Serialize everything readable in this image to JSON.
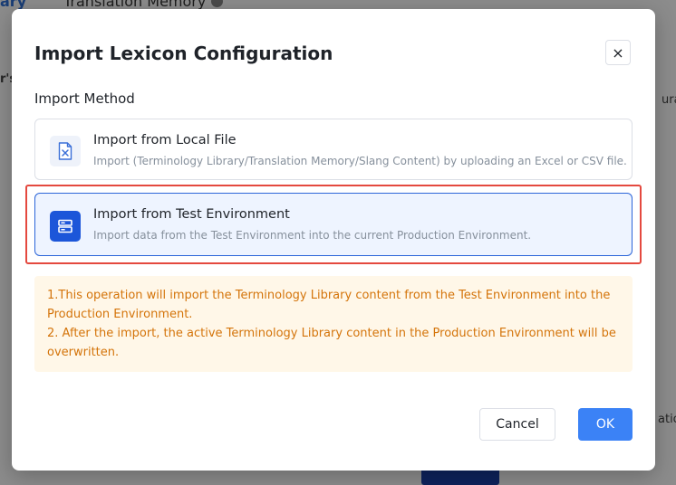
{
  "background": {
    "tab_active_fragment": "ary",
    "tab_translation_memory": "Translation Memory",
    "fragment_left": "r's",
    "fragment_right": "ura",
    "fragment_bottom_right": "atio"
  },
  "dialog": {
    "title": "Import Lexicon Configuration",
    "close_label": "×",
    "section_label": "Import Method",
    "options": [
      {
        "title": "Import from Local File",
        "description": "Import (Terminology Library/Translation Memory/Slang Content) by uploading an Excel or CSV file.",
        "icon": "excel-file-icon",
        "selected": false
      },
      {
        "title": "Import from Test Environment",
        "description": "Import data from the Test Environment into the current Production Environment.",
        "icon": "server-icon",
        "selected": true
      }
    ],
    "notice": [
      "1.This operation will import the Terminology Library content from the Test Environment into the Production Environment.",
      "2. After the import, the active Terminology Library content in the Production Environment will be overwritten."
    ],
    "cancel_label": "Cancel",
    "ok_label": "OK"
  },
  "colors": {
    "accent": "#3b82f6",
    "selected_border": "#2b65d9",
    "highlight": "#e4493f",
    "notice_text": "#d4740a",
    "notice_bg": "#fff7e8"
  }
}
